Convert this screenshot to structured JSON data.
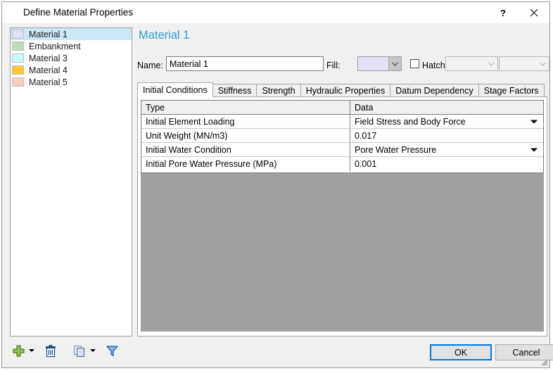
{
  "window": {
    "title": "Define Material Properties",
    "help_icon": "question-mark-icon",
    "close_icon": "close-icon"
  },
  "material_list": {
    "items": [
      {
        "label": "Material 1",
        "color": "#e2e1f5",
        "selected": true
      },
      {
        "label": "Embankment",
        "color": "#c2dcbe",
        "selected": false
      },
      {
        "label": "Material 3",
        "color": "#c6fcfb",
        "selected": false
      },
      {
        "label": "Material 4",
        "color": "#fdc931",
        "selected": false
      },
      {
        "label": "Material 5",
        "color": "#fbcdc6",
        "selected": false
      }
    ],
    "selection_color": "#cbe8f6"
  },
  "toolbar": {
    "add_icon": "plus-icon",
    "add_dropdown_icon": "chevron-down-icon",
    "delete_icon": "trash-icon",
    "copy_icon": "copy-icon",
    "copy_dropdown_icon": "chevron-down-icon",
    "filter_icon": "funnel-icon"
  },
  "content": {
    "heading": "Material 1",
    "heading_color": "#2f9fd8",
    "name_label": "Name:",
    "name_value": "Material 1",
    "fill_label": "Fill:",
    "fill_color": "#e2e1f5",
    "hatch_label": "Hatch:",
    "hatch_checked": false,
    "hatch_value_1": "",
    "hatch_value_2": "",
    "dropdown_icon": "chevron-down-icon"
  },
  "tabs": [
    {
      "label": "Initial Conditions",
      "active": true
    },
    {
      "label": "Stiffness",
      "active": false
    },
    {
      "label": "Strength",
      "active": false
    },
    {
      "label": "Hydraulic Properties",
      "active": false
    },
    {
      "label": "Datum Dependency",
      "active": false
    },
    {
      "label": "Stage Factors",
      "active": false
    }
  ],
  "grid": {
    "headers": {
      "type": "Type",
      "data": "Data"
    },
    "rows": [
      {
        "type": "Initial Element Loading",
        "data": "Field Stress and Body Force",
        "dropdown": true
      },
      {
        "type": "Unit Weight (MN/m3)",
        "data": "0.017",
        "dropdown": false
      },
      {
        "type": "Initial Water Condition",
        "data": "Pore Water Pressure",
        "dropdown": true
      },
      {
        "type": "Initial Pore Water Pressure (MPa)",
        "data": "0.001",
        "dropdown": false
      }
    ]
  },
  "footer": {
    "ok_label": "OK",
    "cancel_label": "Cancel"
  }
}
